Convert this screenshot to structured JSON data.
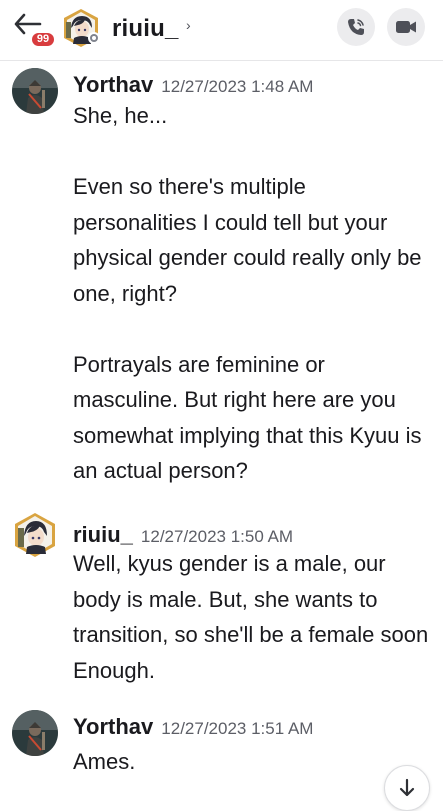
{
  "header": {
    "unread_badge": "99",
    "title": "riuiu_",
    "chevron": "›",
    "back_icon": "arrow-left-icon",
    "call_icon": "phone-icon",
    "video_icon": "video-camera-icon"
  },
  "messages": [
    {
      "author": "Yorthav",
      "timestamp": "12/27/2023 1:48 AM",
      "text": "She, he...\n\nEven so there's multiple personalities I could tell but your physical gender could really only be one, right?\n\nPortrayals are feminine or masculine. But right here are you somewhat implying that this Kyuu is an actual person?"
    },
    {
      "author": "riuiu_",
      "timestamp": "12/27/2023 1:50 AM",
      "text": "Well, kyus gender is a male, our body is male. But, she wants to transition, so she'll be a female soon Enough."
    },
    {
      "author": "Yorthav",
      "timestamp": "12/27/2023 1:51 AM",
      "text": "Ames."
    }
  ],
  "colors": {
    "badge": "#d83c3e",
    "text": "#1a1a1e",
    "timestamp": "#5c5e66",
    "button_bg": "#ececee"
  },
  "jump_icon": "arrow-down-icon"
}
